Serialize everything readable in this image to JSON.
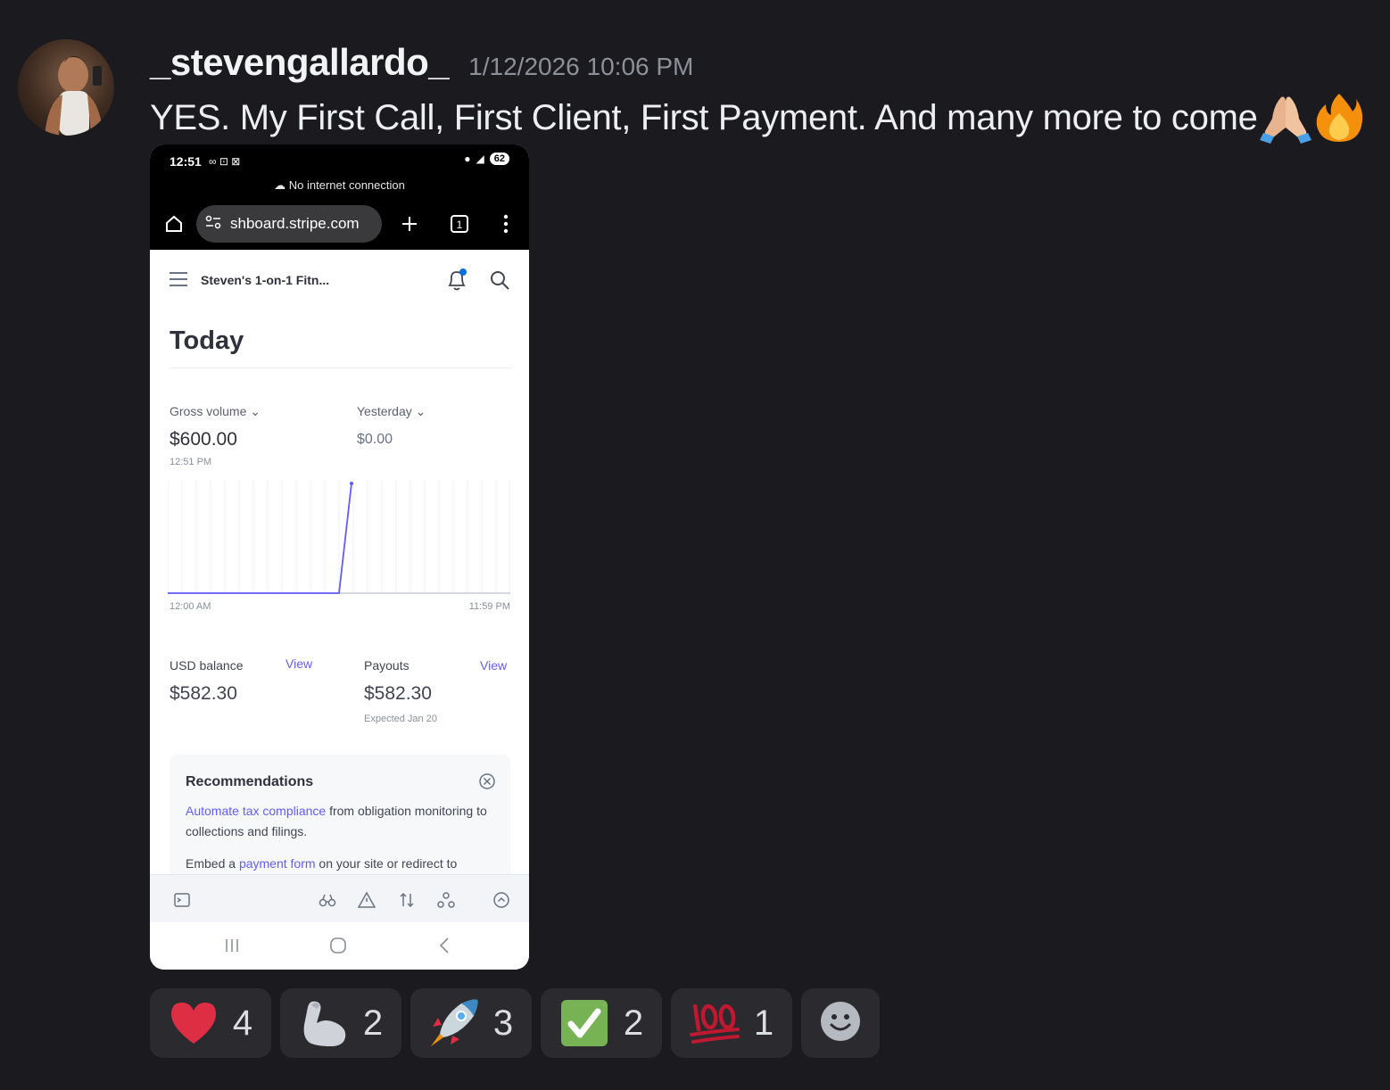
{
  "message": {
    "username": "_stevengallardo_",
    "timestamp": "1/12/2026 10:06 PM",
    "text": "YES. My First Call, First Client, First Payment. And many more to come",
    "trailing_emojis": [
      "folded-hands",
      "fire"
    ]
  },
  "phone": {
    "status_time": "12:51",
    "battery": "62",
    "no_internet": "No internet connection",
    "url": "shboard.stripe.com",
    "tab_count": "1",
    "account_name": "Steven's 1-on-1 Fitn...",
    "page_title": "Today",
    "gross_volume_label": "Gross volume",
    "gross_volume_value": "$600.00",
    "gross_volume_time": "12:51 PM",
    "yesterday_label": "Yesterday",
    "yesterday_value": "$0.00",
    "chart_start": "12:00 AM",
    "chart_end": "11:59 PM",
    "usd_balance_label": "USD balance",
    "usd_balance_value": "$582.30",
    "payouts_label": "Payouts",
    "payouts_value": "$582.30",
    "payouts_expected": "Expected Jan 20",
    "view_label": "View",
    "reco_title": "Recommendations",
    "reco_1_link": "Automate tax compliance",
    "reco_1_text": " from obligation monitoring to collections and filings.",
    "reco_2_prefix": "Embed a ",
    "reco_2_link": "payment form",
    "reco_2_text": " on your site or redirect to"
  },
  "reactions": [
    {
      "emoji": "heart",
      "count": "4"
    },
    {
      "emoji": "flexed-biceps",
      "count": "2"
    },
    {
      "emoji": "rocket",
      "count": "3"
    },
    {
      "emoji": "check-mark-button",
      "count": "2"
    },
    {
      "emoji": "hundred-points",
      "count": "1"
    }
  ],
  "colors": {
    "background": "#1b1a1f",
    "reaction_bg": "#2a2a2f",
    "stripe_accent": "#635bff"
  }
}
